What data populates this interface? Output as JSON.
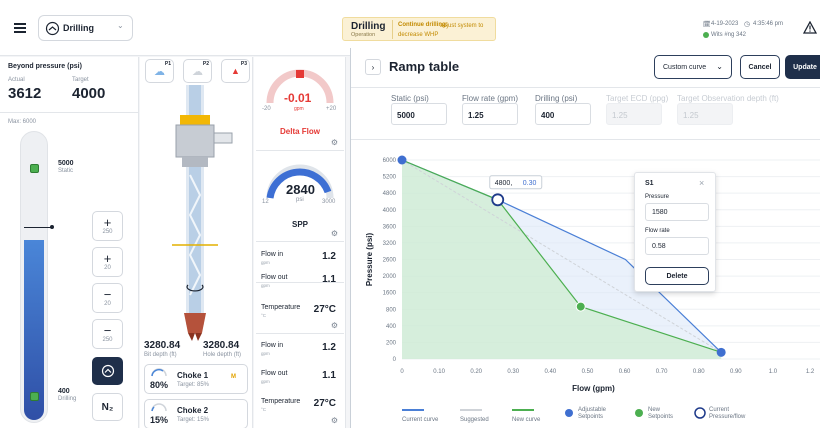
{
  "header": {
    "operation_title": "Drilling",
    "operation_subtitle": "Operation",
    "alert_bold": "Continue drilling:",
    "alert_text": "adjust system to decrease WHP",
    "mode_label": "Drilling",
    "date": "4-19-2023",
    "time": "4:35:46 pm",
    "wits": "Wits #ng 342"
  },
  "pressure": {
    "title": "Beyond pressure (psi)",
    "actual_label": "Actual",
    "actual_value": "3612",
    "target_label": "Target",
    "target_value": "4000",
    "max_label": "Max: 6000",
    "static_value": "5000",
    "static_label": "Static",
    "drilling_value": "400",
    "drilling_label": "Drilling",
    "steps": [
      {
        "sign": "+",
        "amount": "250"
      },
      {
        "sign": "+",
        "amount": "20"
      },
      {
        "sign": "−",
        "amount": "20"
      },
      {
        "sign": "−",
        "amount": "250"
      }
    ],
    "n2_label": "N₂"
  },
  "well": {
    "pumps": [
      "P1",
      "P2",
      "P3"
    ],
    "bit_depth": "3280.84",
    "bit_depth_label": "Bit depth (ft)",
    "hole_depth": "3280.84",
    "hole_depth_label": "Hole depth (ft)",
    "chokes": [
      {
        "name": "Choke 1",
        "percent": "80%",
        "target": "Target: 85%",
        "mode": "M"
      },
      {
        "name": "Choke 2",
        "percent": "15%",
        "target": "Target: 15%",
        "mode": ""
      }
    ]
  },
  "gauges": {
    "delta_flow": {
      "value": "-0.01",
      "unit": "gpm",
      "min": "-20",
      "max": "+20",
      "label": "Delta Flow",
      "fraction": 0.5
    },
    "spp": {
      "value": "2840",
      "unit": "psi",
      "min": "12",
      "max": "3000",
      "label": "SPP",
      "fraction": 0.95
    }
  },
  "metrics": [
    {
      "label": "Flow in",
      "unit": "gpm",
      "value": "1.2"
    },
    {
      "label": "Flow out",
      "unit": "gpm",
      "value": "1.1"
    },
    {
      "label": "Temperature",
      "unit": "°C",
      "value": "27°C"
    },
    {
      "label": "Flow in",
      "unit": "gpm",
      "value": "1.2"
    },
    {
      "label": "Flow out",
      "unit": "gpm",
      "value": "1.1"
    },
    {
      "label": "Temperature",
      "unit": "°C",
      "value": "27°C"
    }
  ],
  "ramp": {
    "title": "Ramp table",
    "curve_select": "Custom curve",
    "cancel": "Cancel",
    "update": "Update",
    "fields": [
      {
        "label": "Static (psi)",
        "value": "5000",
        "disabled": false
      },
      {
        "label": "Flow rate (gpm)",
        "value": "1.25",
        "disabled": false
      },
      {
        "label": "Drilling (psi)",
        "value": "400",
        "disabled": false
      },
      {
        "label": "Target ECD (ppg)",
        "value": "1.25",
        "disabled": true
      },
      {
        "label": "Target Observation depth (ft)",
        "value": "1.25",
        "disabled": true
      }
    ]
  },
  "popup": {
    "title": "S1",
    "pressure_label": "Pressure",
    "pressure_value": "1580",
    "flow_label": "Flow rate",
    "flow_value": "0.58",
    "delete": "Delete"
  },
  "chart_data": {
    "type": "line",
    "xlabel": "Flow  (gpm)",
    "ylabel": "Pressure (psi)",
    "xlim": [
      0,
      1.2
    ],
    "ylim": [
      0,
      6000
    ],
    "x_ticks": [
      "0",
      "0.10",
      "0.20",
      "0.30",
      "0.40",
      "0.50",
      "0.60",
      "0.70",
      "0.80",
      "0.90",
      "1.0",
      "1.2"
    ],
    "y_ticks": [
      "6000",
      "5200",
      "4800",
      "4000",
      "3600",
      "3200",
      "2600",
      "2000",
      "1600",
      "800",
      "400",
      "200",
      "0"
    ],
    "tooltip": {
      "x": "4800,",
      "y": "0.30"
    },
    "grid": true,
    "series": [
      {
        "name": "Current curve",
        "color": "#4a7fd6",
        "points": [
          [
            0,
            6000
          ],
          [
            0.3,
            4800
          ],
          [
            0.7,
            3000
          ],
          [
            1.0,
            200
          ]
        ]
      },
      {
        "name": "Suggested",
        "color": "#cfd3d8",
        "points": [
          [
            0,
            6000
          ],
          [
            1.0,
            200
          ]
        ]
      },
      {
        "name": "New curve",
        "color": "#4caf50",
        "points": [
          [
            0,
            6000
          ],
          [
            0.3,
            4800
          ],
          [
            0.56,
            1580
          ],
          [
            1.0,
            200
          ]
        ]
      }
    ],
    "legend": [
      {
        "name": "Current curve",
        "kind": "line",
        "color": "#4a7fd6"
      },
      {
        "name": "Suggested",
        "kind": "line",
        "color": "#cfd3d8"
      },
      {
        "name": "New curve",
        "kind": "line",
        "color": "#4caf50"
      },
      {
        "name": "Adjustable Setpoints",
        "kind": "dot",
        "color": "#3f6fd0"
      },
      {
        "name": "New Setpoints",
        "kind": "dot",
        "color": "#4caf50"
      },
      {
        "name": "Current Pressure/flow",
        "kind": "ring",
        "color": "#1e3a8a"
      }
    ]
  }
}
